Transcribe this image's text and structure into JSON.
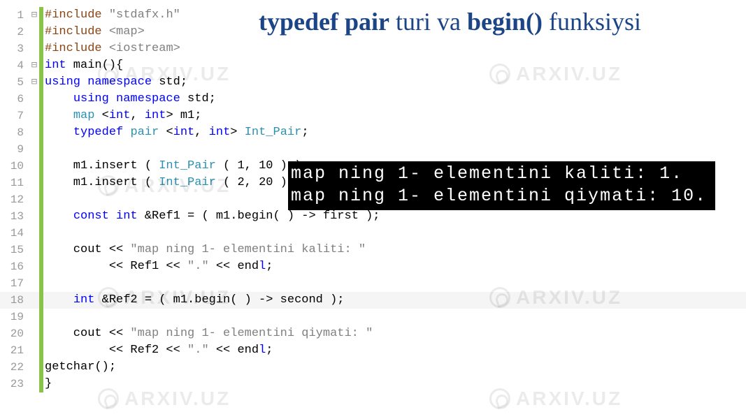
{
  "title": {
    "part1": "typedef pair",
    "part2": " turi va ",
    "part3": "begin()",
    "part4": " funksiysi"
  },
  "console": {
    "line1": "map ning 1- elementini kaliti: 1.",
    "line2": "map ning 1- elementini qiymati: 10."
  },
  "watermark_text": "ARXIV.UZ",
  "code": {
    "lines": [
      {
        "num": "1",
        "fold": "⊟",
        "mark": true,
        "tokens": [
          {
            "cls": "c-pre",
            "t": "#include "
          },
          {
            "cls": "c-str",
            "t": "\"stdafx.h\""
          }
        ]
      },
      {
        "num": "2",
        "fold": "",
        "mark": true,
        "tokens": [
          {
            "cls": "c-pre",
            "t": "#include "
          },
          {
            "cls": "c-str",
            "t": "<map>"
          }
        ]
      },
      {
        "num": "3",
        "fold": "",
        "mark": true,
        "tokens": [
          {
            "cls": "c-pre",
            "t": "#include "
          },
          {
            "cls": "c-str",
            "t": "<iostream>"
          }
        ]
      },
      {
        "num": "4",
        "fold": "⊟",
        "mark": true,
        "tokens": [
          {
            "cls": "c-kw",
            "t": "int"
          },
          {
            "cls": "c-id",
            "t": " main"
          },
          {
            "cls": "c-op",
            "t": "()"
          },
          {
            "cls": "c-brace",
            "t": "{"
          }
        ]
      },
      {
        "num": "5",
        "fold": "⊟",
        "mark": true,
        "tokens": [
          {
            "cls": "c-kw",
            "t": "using namespace"
          },
          {
            "cls": "c-id",
            "t": " std"
          },
          {
            "cls": "c-op",
            "t": ";"
          }
        ]
      },
      {
        "num": "6",
        "fold": "",
        "mark": true,
        "tokens": [
          {
            "cls": "c-id",
            "t": "    "
          },
          {
            "cls": "c-kw",
            "t": "using namespace"
          },
          {
            "cls": "c-id",
            "t": " std"
          },
          {
            "cls": "c-op",
            "t": ";"
          }
        ]
      },
      {
        "num": "7",
        "fold": "",
        "mark": true,
        "tokens": [
          {
            "cls": "c-id",
            "t": "    "
          },
          {
            "cls": "c-type",
            "t": "map"
          },
          {
            "cls": "c-id",
            "t": " <"
          },
          {
            "cls": "c-kw",
            "t": "int"
          },
          {
            "cls": "c-op",
            "t": ", "
          },
          {
            "cls": "c-kw",
            "t": "int"
          },
          {
            "cls": "c-op",
            "t": "> m1;"
          }
        ]
      },
      {
        "num": "8",
        "fold": "",
        "mark": true,
        "tokens": [
          {
            "cls": "c-id",
            "t": "    "
          },
          {
            "cls": "c-kw",
            "t": "typedef"
          },
          {
            "cls": "c-id",
            "t": " "
          },
          {
            "cls": "c-type",
            "t": "pair"
          },
          {
            "cls": "c-id",
            "t": " <"
          },
          {
            "cls": "c-kw",
            "t": "int"
          },
          {
            "cls": "c-op",
            "t": ", "
          },
          {
            "cls": "c-kw",
            "t": "int"
          },
          {
            "cls": "c-op",
            "t": "> "
          },
          {
            "cls": "c-type",
            "t": "Int_Pair"
          },
          {
            "cls": "c-op",
            "t": ";"
          }
        ]
      },
      {
        "num": "9",
        "fold": "",
        "mark": true,
        "tokens": []
      },
      {
        "num": "10",
        "fold": "",
        "mark": true,
        "tokens": [
          {
            "cls": "c-id",
            "t": "    m1.insert ( "
          },
          {
            "cls": "c-type",
            "t": "Int_Pair"
          },
          {
            "cls": "c-id",
            "t": " ( 1, 10 ) );"
          }
        ]
      },
      {
        "num": "11",
        "fold": "",
        "mark": true,
        "tokens": [
          {
            "cls": "c-id",
            "t": "    m1.insert ( "
          },
          {
            "cls": "c-type",
            "t": "Int_Pair"
          },
          {
            "cls": "c-id",
            "t": " ( 2, 20 ) );"
          }
        ]
      },
      {
        "num": "12",
        "fold": "",
        "mark": true,
        "tokens": []
      },
      {
        "num": "13",
        "fold": "",
        "mark": true,
        "tokens": [
          {
            "cls": "c-id",
            "t": "    "
          },
          {
            "cls": "c-kw",
            "t": "const int"
          },
          {
            "cls": "c-id",
            "t": " &Ref1 = ( m1.begin( ) -> first );"
          }
        ]
      },
      {
        "num": "14",
        "fold": "",
        "mark": true,
        "tokens": []
      },
      {
        "num": "15",
        "fold": "",
        "mark": true,
        "tokens": [
          {
            "cls": "c-id",
            "t": "    cout << "
          },
          {
            "cls": "c-str",
            "t": "\"map ning 1- elementini kaliti: \""
          }
        ]
      },
      {
        "num": "16",
        "fold": "",
        "mark": true,
        "tokens": [
          {
            "cls": "c-id",
            "t": "         << Ref1 << "
          },
          {
            "cls": "c-str",
            "t": "\".\""
          },
          {
            "cls": "c-id",
            "t": " << end"
          },
          {
            "cls": "c-kw",
            "t": "l"
          },
          {
            "cls": "c-id",
            "t": ";"
          }
        ]
      },
      {
        "num": "17",
        "fold": "",
        "mark": true,
        "tokens": []
      },
      {
        "num": "18",
        "fold": "",
        "mark": true,
        "highlight": true,
        "tokens": [
          {
            "cls": "c-id",
            "t": "    "
          },
          {
            "cls": "c-kw",
            "t": "int"
          },
          {
            "cls": "c-id",
            "t": " &Ref2 = ( m1.begin( ) -> second );"
          }
        ]
      },
      {
        "num": "19",
        "fold": "",
        "mark": true,
        "tokens": []
      },
      {
        "num": "20",
        "fold": "",
        "mark": true,
        "tokens": [
          {
            "cls": "c-id",
            "t": "    cout << "
          },
          {
            "cls": "c-str",
            "t": "\"map ning 1- elementini qiymati: \""
          }
        ]
      },
      {
        "num": "21",
        "fold": "",
        "mark": true,
        "tokens": [
          {
            "cls": "c-id",
            "t": "         << Ref2 << "
          },
          {
            "cls": "c-str",
            "t": "\".\""
          },
          {
            "cls": "c-id",
            "t": " << end"
          },
          {
            "cls": "c-kw",
            "t": "l"
          },
          {
            "cls": "c-id",
            "t": ";"
          }
        ]
      },
      {
        "num": "22",
        "fold": "",
        "mark": true,
        "tokens": [
          {
            "cls": "c-id",
            "t": "getchar();"
          }
        ]
      },
      {
        "num": "23",
        "fold": "",
        "mark": true,
        "tokens": [
          {
            "cls": "c-brace",
            "t": "}"
          }
        ]
      }
    ]
  }
}
